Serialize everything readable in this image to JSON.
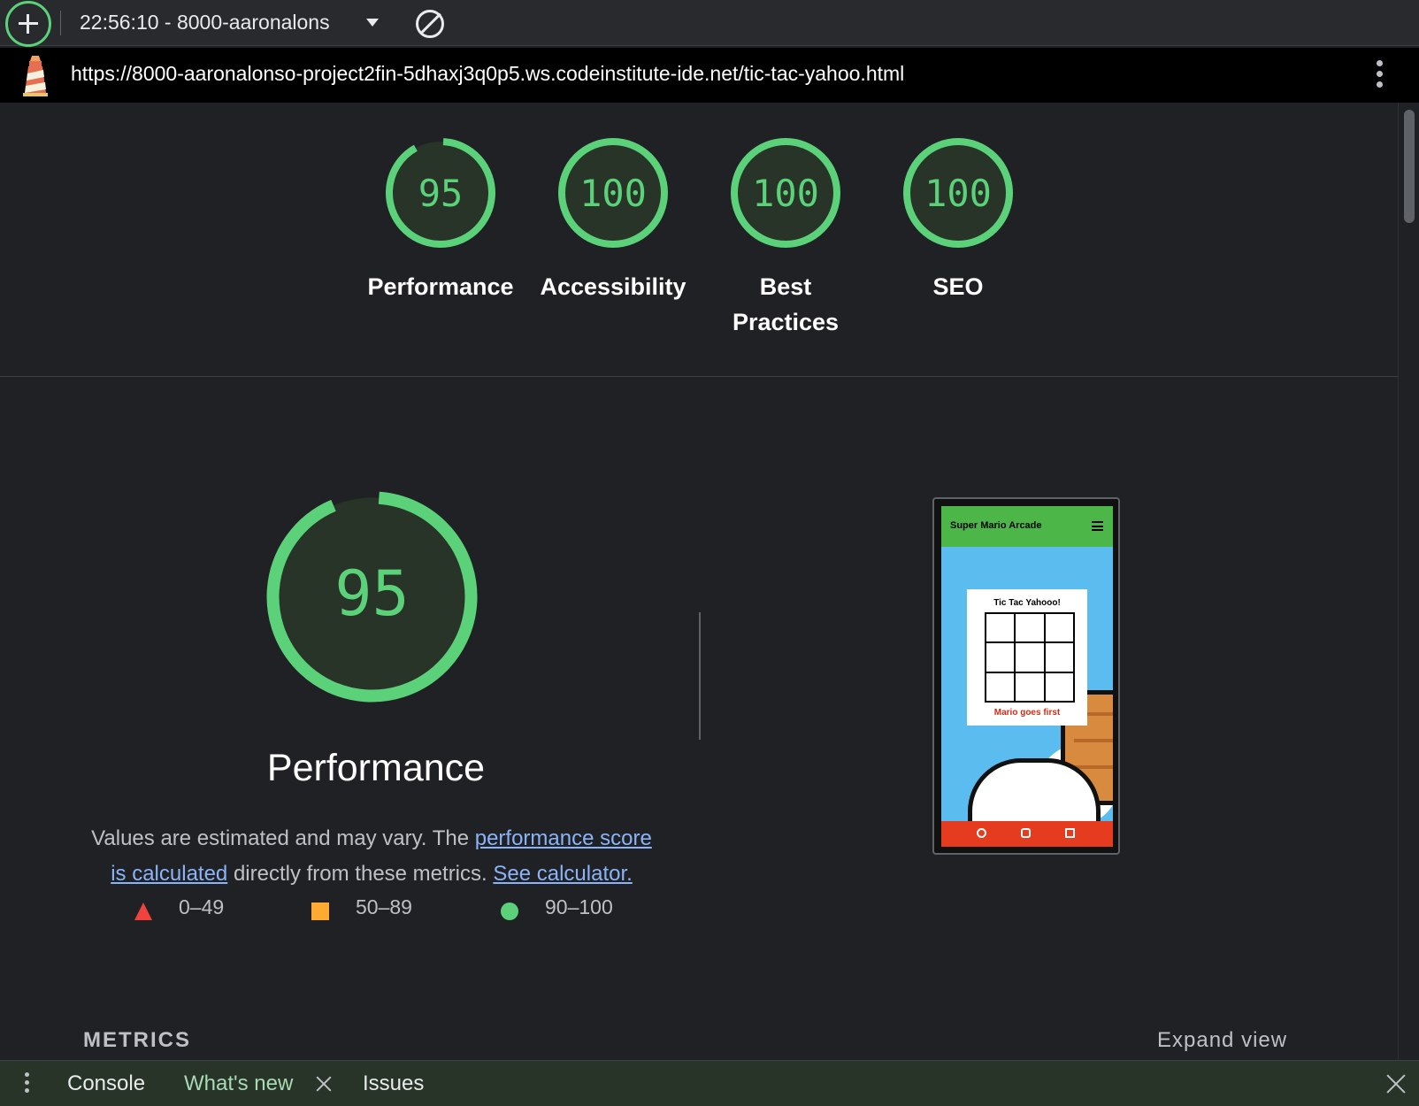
{
  "toolbar": {
    "report_select": "22:56:10 - 8000-aaronalons",
    "clear_icon": "block-icon",
    "new_report_icon": "plus-icon"
  },
  "urlbar": {
    "url": "https://8000-aaronalonso-project2fin-5dhaxj3q0p5.ws.codeinstitute-ide.net/tic-tac-yahoo.html"
  },
  "categories": [
    {
      "score": "95",
      "label": "Performance",
      "value": 95
    },
    {
      "score": "100",
      "label": "Accessibility",
      "value": 100
    },
    {
      "score": "100",
      "label": "Best Practices",
      "value": 100
    },
    {
      "score": "100",
      "label": "SEO",
      "value": 100
    }
  ],
  "performance": {
    "score": "95",
    "value": 95,
    "title": "Performance",
    "desc_prefix": "Values are estimated and may vary. The ",
    "link_score": "performance score is calculated",
    "desc_middle": " directly from these metrics. ",
    "link_calculator": "See calculator."
  },
  "legend": {
    "fail": "0–49",
    "average": "50–89",
    "pass": "90–100"
  },
  "thumbnail": {
    "brand": "Super Mario Arcade",
    "card_title": "Tic Tac Yahooo!",
    "status": "Mario goes first"
  },
  "metrics": {
    "title": "METRICS",
    "expand": "Expand view"
  },
  "drawer": {
    "tab_console": "Console",
    "tab_whats_new": "What's new",
    "tab_issues": "Issues"
  },
  "colors": {
    "pass": "#5bd27a",
    "average": "#ffaa33",
    "fail": "#f0433e",
    "link": "#8ab4f8"
  }
}
